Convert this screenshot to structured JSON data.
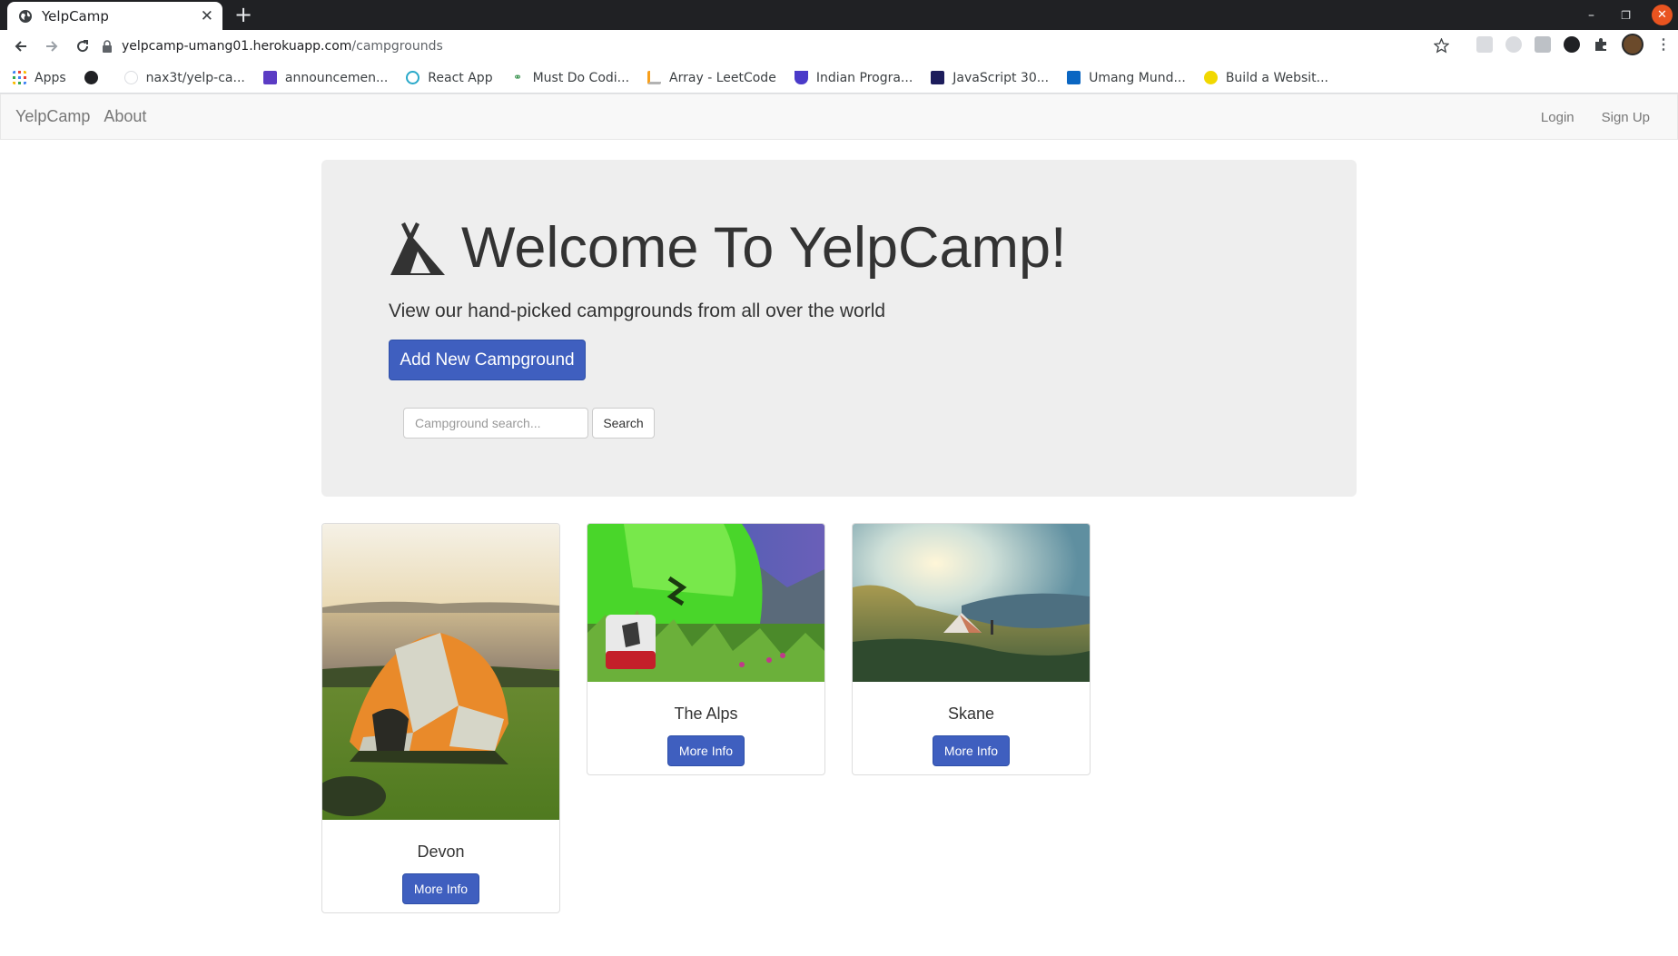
{
  "browser": {
    "tab_title": "YelpCamp",
    "url_host": "yelpcamp-umang01.herokuapp.com",
    "url_path": "/campgrounds",
    "bookmarks": [
      {
        "label": "Apps",
        "color": "#4285f4"
      },
      {
        "label": "",
        "color": "#202124"
      },
      {
        "label": "nax3t/yelp-ca...",
        "color": "#ffffff"
      },
      {
        "label": "announcemen...",
        "color": "#5b3cc4"
      },
      {
        "label": "React App",
        "color": "#2aa9c9"
      },
      {
        "label": "Must Do Codi...",
        "color": "#2f8d46"
      },
      {
        "label": "Array - LeetCode",
        "color": "#f89f1b"
      },
      {
        "label": "Indian Progra...",
        "color": "#4a3ac9"
      },
      {
        "label": "JavaScript 30...",
        "color": "#1d1d5c"
      },
      {
        "label": "Umang Mund...",
        "color": "#0a66c2"
      },
      {
        "label": "Build a Websit...",
        "color": "#f1d800"
      }
    ]
  },
  "navbar": {
    "brand": "YelpCamp",
    "about": "About",
    "login": "Login",
    "signup": "Sign Up"
  },
  "jumbotron": {
    "title": "Welcome To YelpCamp!",
    "subtitle": "View our hand-picked campgrounds from all over the world",
    "add_button": "Add New Campground",
    "search_placeholder": "Campground search...",
    "search_button": "Search"
  },
  "campgrounds": [
    {
      "name": "Devon",
      "button": "More Info"
    },
    {
      "name": "The Alps",
      "button": "More Info"
    },
    {
      "name": "Skane",
      "button": "More Info"
    }
  ],
  "colors": {
    "primary_button": "#3f5fbf",
    "jumbotron_bg": "#eeeeee",
    "navbar_bg": "#f8f8f8"
  }
}
